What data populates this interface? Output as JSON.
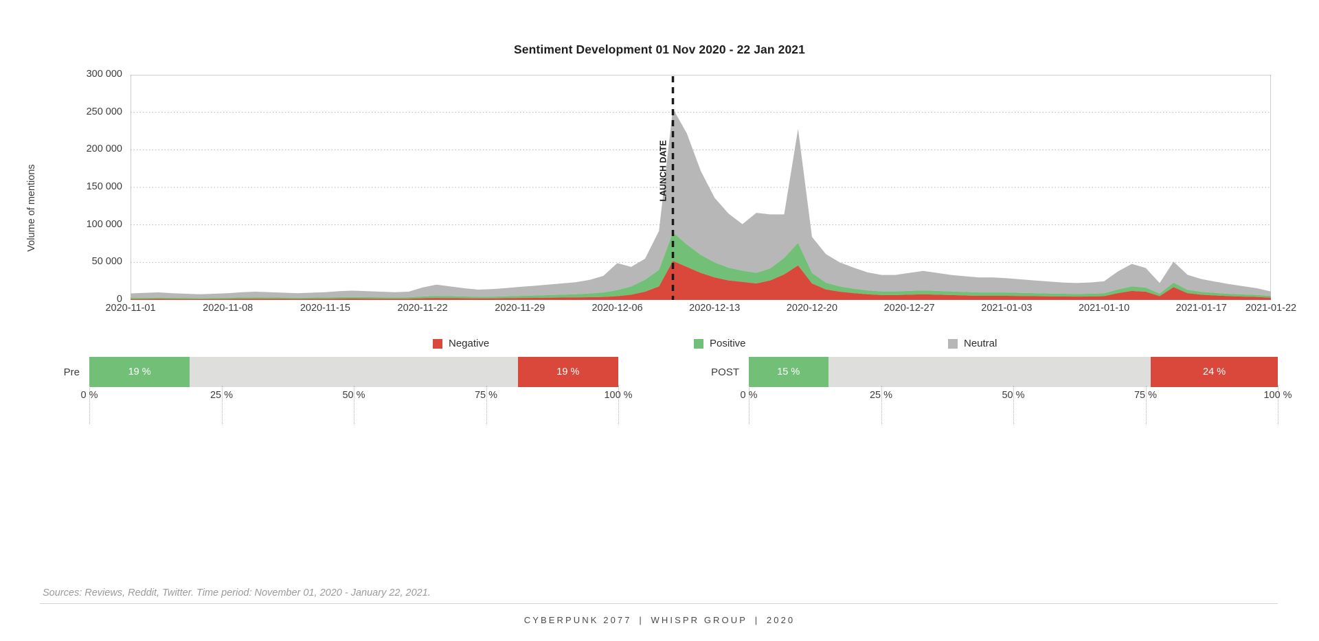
{
  "title": "Sentiment Development 01 Nov 2020  - 22 Jan 2021",
  "colors": {
    "negative": "#d9483a",
    "positive": "#72bf78",
    "neutral": "#b7b7b7",
    "neutral_bar": "#dededd",
    "axis": "#9a9a9a",
    "grid": "#b4b4b4",
    "launch_line": "#1a1a1a"
  },
  "annotation": {
    "launch_label": "LAUNCH DATE",
    "launch_date": "2020-12-10"
  },
  "legend": {
    "position": "below-plot",
    "items": [
      {
        "label": "Negative",
        "color": "#d9483a"
      },
      {
        "label": "Positive",
        "color": "#72bf78"
      },
      {
        "label": "Neutral",
        "color": "#b7b7b7"
      }
    ]
  },
  "pre_bar": {
    "label": "Pre",
    "positive_label": "19 %",
    "negative_label": "19 %",
    "positive": 19,
    "neutral": 62,
    "negative": 19,
    "ticks": [
      "0 %",
      "25 %",
      "50 %",
      "75 %",
      "100 %"
    ]
  },
  "post_bar": {
    "label": "POST",
    "positive_label": "15 %",
    "negative_label": "24 %",
    "positive": 15,
    "neutral": 61,
    "negative": 24,
    "ticks": [
      "0 %",
      "25 %",
      "50 %",
      "75 %",
      "100 %"
    ]
  },
  "sources_note": "Sources: Reviews, Reddit, Twitter. Time period: November 01, 2020 - January 22, 2021.",
  "footer": {
    "brand": "CYBERPUNK 2077",
    "separator_1": "|",
    "agency": "WHISPR GROUP",
    "separator_2": "|",
    "year": "2020"
  },
  "chart_data": {
    "type": "area",
    "stacked": true,
    "title": "Sentiment Development 01 Nov 2020  - 22 Jan 2021",
    "xlabel": "",
    "ylabel": "Volume of mentions",
    "ylim": [
      0,
      300000
    ],
    "yticks": [
      0,
      50000,
      100000,
      150000,
      200000,
      250000,
      300000
    ],
    "ytick_labels": [
      "0",
      "50 000",
      "100 000",
      "150 000",
      "200 000",
      "250 000",
      "300 000"
    ],
    "grid": true,
    "xtick_labels": [
      "2020-11-01",
      "2020-11-08",
      "2020-11-15",
      "2020-11-22",
      "2020-11-29",
      "2020-12-06",
      "2020-12-13",
      "2020-12-20",
      "2020-12-27",
      "2021-01-03",
      "2021-01-10",
      "2021-01-17",
      "2021-01-22"
    ],
    "x": [
      "2020-11-01",
      "2020-11-02",
      "2020-11-03",
      "2020-11-04",
      "2020-11-05",
      "2020-11-06",
      "2020-11-07",
      "2020-11-08",
      "2020-11-09",
      "2020-11-10",
      "2020-11-11",
      "2020-11-12",
      "2020-11-13",
      "2020-11-14",
      "2020-11-15",
      "2020-11-16",
      "2020-11-17",
      "2020-11-18",
      "2020-11-19",
      "2020-11-20",
      "2020-11-21",
      "2020-11-22",
      "2020-11-23",
      "2020-11-24",
      "2020-11-25",
      "2020-11-26",
      "2020-11-27",
      "2020-11-28",
      "2020-11-29",
      "2020-11-30",
      "2020-12-01",
      "2020-12-02",
      "2020-12-03",
      "2020-12-04",
      "2020-12-05",
      "2020-12-06",
      "2020-12-07",
      "2020-12-08",
      "2020-12-09",
      "2020-12-10",
      "2020-12-11",
      "2020-12-12",
      "2020-12-13",
      "2020-12-14",
      "2020-12-15",
      "2020-12-16",
      "2020-12-17",
      "2020-12-18",
      "2020-12-19",
      "2020-12-20",
      "2020-12-21",
      "2020-12-22",
      "2020-12-23",
      "2020-12-24",
      "2020-12-25",
      "2020-12-26",
      "2020-12-27",
      "2020-12-28",
      "2020-12-29",
      "2020-12-30",
      "2020-12-31",
      "2021-01-01",
      "2021-01-02",
      "2021-01-03",
      "2021-01-04",
      "2021-01-05",
      "2021-01-06",
      "2021-01-07",
      "2021-01-08",
      "2021-01-09",
      "2021-01-10",
      "2021-01-11",
      "2021-01-12",
      "2021-01-13",
      "2021-01-14",
      "2021-01-15",
      "2021-01-16",
      "2021-01-17",
      "2021-01-18",
      "2021-01-19",
      "2021-01-20",
      "2021-01-21",
      "2021-01-22"
    ],
    "series": [
      {
        "name": "Negative",
        "color": "#d9483a",
        "values": [
          1200,
          1300,
          1400,
          1300,
          1200,
          1100,
          1200,
          1300,
          1500,
          1600,
          1500,
          1400,
          1300,
          1400,
          1500,
          1700,
          1800,
          1700,
          1600,
          1500,
          1600,
          2200,
          2600,
          2400,
          2200,
          2000,
          2100,
          2300,
          2600,
          2800,
          3000,
          3200,
          3400,
          3600,
          4000,
          5000,
          7000,
          11000,
          18000,
          52000,
          44000,
          36000,
          30000,
          26000,
          24000,
          22000,
          26000,
          34000,
          46000,
          22000,
          14000,
          11000,
          9000,
          7500,
          6500,
          6500,
          7000,
          7500,
          7000,
          6500,
          6000,
          5500,
          5500,
          5500,
          5200,
          5000,
          4800,
          4600,
          4500,
          4600,
          5000,
          9000,
          12000,
          11000,
          5000,
          17000,
          9000,
          7000,
          6000,
          5000,
          4500,
          4000,
          3000
        ]
      },
      {
        "name": "Positive",
        "color": "#72bf78",
        "values": [
          1500,
          1600,
          1700,
          1600,
          1500,
          1400,
          1500,
          1600,
          1800,
          1900,
          1800,
          1700,
          1600,
          1700,
          1800,
          2000,
          2100,
          2000,
          1900,
          1800,
          1900,
          2400,
          2800,
          2600,
          2400,
          2200,
          2300,
          2500,
          2800,
          3000,
          3400,
          3800,
          4200,
          5000,
          6000,
          8000,
          11000,
          16000,
          22000,
          38000,
          30000,
          24000,
          20000,
          17000,
          15000,
          14000,
          16000,
          22000,
          30000,
          14000,
          9000,
          7000,
          6000,
          5200,
          4800,
          4800,
          5000,
          5200,
          5000,
          4800,
          4600,
          4400,
          4400,
          4400,
          4200,
          4000,
          3800,
          3600,
          3500,
          3600,
          3800,
          5000,
          6000,
          5500,
          3500,
          6000,
          4500,
          3800,
          3400,
          3000,
          2800,
          2600,
          2200
        ]
      },
      {
        "name": "Neutral",
        "color": "#b7b7b7",
        "values": [
          6000,
          6500,
          7000,
          6000,
          5500,
          5000,
          5500,
          6000,
          7000,
          7500,
          7000,
          6500,
          6000,
          6500,
          7000,
          8000,
          8500,
          8000,
          7500,
          7000,
          7500,
          12000,
          15000,
          13000,
          11000,
          9500,
          10000,
          11000,
          12000,
          13000,
          14000,
          15000,
          16000,
          18000,
          22000,
          36000,
          26000,
          28000,
          52000,
          165000,
          148000,
          112000,
          86000,
          72000,
          62000,
          80000,
          72000,
          58000,
          152000,
          48000,
          38000,
          32000,
          28000,
          24000,
          22000,
          22000,
          24000,
          26000,
          24000,
          22000,
          21000,
          20000,
          20000,
          19000,
          18000,
          17000,
          16000,
          15000,
          14500,
          15000,
          16000,
          24000,
          30000,
          26000,
          14000,
          28000,
          20000,
          17000,
          15000,
          13000,
          11000,
          9000,
          6000
        ]
      }
    ]
  }
}
